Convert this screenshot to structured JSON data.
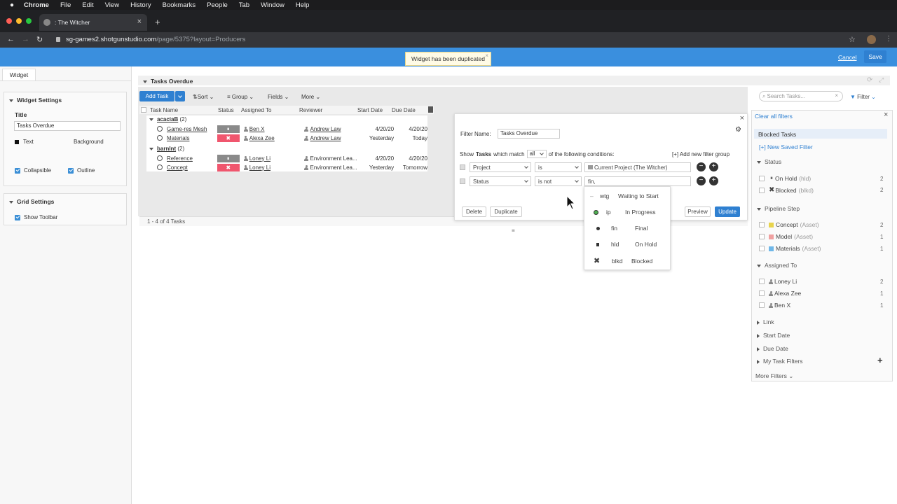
{
  "menubar": {
    "app": "Chrome",
    "items": [
      "File",
      "Edit",
      "View",
      "History",
      "Bookmarks",
      "People",
      "Tab",
      "Window",
      "Help"
    ]
  },
  "browser": {
    "tab_title": ": The Witcher",
    "url_host": "sg-games2.shotgunstudio.com",
    "url_path": "/page/5375?layout=Producers"
  },
  "topbar": {
    "toast": "Widget has been duplicated",
    "cancel": "Cancel",
    "save": "Save"
  },
  "left": {
    "tab": "Widget",
    "widget_settings": "Widget Settings",
    "title_label": "Title",
    "title_value": "Tasks Overdue",
    "text_label": "Text",
    "background_label": "Background",
    "collapsible": "Collapsible",
    "outline": "Outline",
    "grid_settings": "Grid Settings",
    "show_toolbar": "Show Toolbar"
  },
  "widget": {
    "title": "Tasks Overdue",
    "add_task": "Add Task",
    "toolbar": [
      "Sort",
      "Group",
      "Fields",
      "More"
    ],
    "search_placeholder": "Search Tasks...",
    "filter": "Filter",
    "columns": [
      "Task Name",
      "Status",
      "Assigned To",
      "Reviewer",
      "Start Date",
      "Due Date"
    ],
    "groups": [
      {
        "name": "acaciaB",
        "count": "(2)",
        "rows": [
          {
            "task": "Game-res Mesh",
            "status": "hld",
            "assigned": "Ben X",
            "reviewer": "Andrew Law",
            "start": "4/20/20",
            "due": "4/20/20"
          },
          {
            "task": "Materials",
            "status": "blkd",
            "assigned": "Alexa Zee",
            "reviewer": "Andrew Law",
            "start": "Yesterday",
            "due": "Today"
          }
        ]
      },
      {
        "name": "barnInt",
        "count": "(2)",
        "rows": [
          {
            "task": "Reference",
            "status": "hld",
            "assigned": "Loney Li",
            "reviewer": "Environment Lea...",
            "start": "4/20/20",
            "due": "4/20/20"
          },
          {
            "task": "Concept",
            "status": "blkd",
            "assigned": "Loney Li",
            "reviewer": "Environment Lea...",
            "start": "Yesterday",
            "due": "Tomorrow"
          }
        ]
      }
    ],
    "footer": "1 - 4 of 4 Tasks"
  },
  "filter_dialog": {
    "name_label": "Filter Name:",
    "name_value": "Tasks Overdue",
    "show_prefix": "Show",
    "show_entity": "Tasks",
    "show_match": "which match",
    "match_value": "all",
    "show_suffix": "of the following conditions:",
    "add_group": "[+] Add new filter group",
    "conditions": [
      {
        "field": "Project",
        "op": "is",
        "value": "Current Project (The Witcher)"
      },
      {
        "field": "Status",
        "op": "is not",
        "value": "fin,"
      }
    ],
    "delete": "Delete",
    "duplicate": "Duplicate",
    "preview": "Preview",
    "update": "Update",
    "dropdown": [
      {
        "code": "wtg",
        "label": "Waiting to Start"
      },
      {
        "code": "ip",
        "label": "In Progress"
      },
      {
        "code": "fin",
        "label": "Final"
      },
      {
        "code": "hld",
        "label": "On Hold"
      },
      {
        "code": "blkd",
        "label": "Blocked"
      }
    ]
  },
  "filter_panel": {
    "clear": "Clear all filters",
    "saved": "Blocked Tasks",
    "new_saved": "[+] New Saved Filter",
    "status_title": "Status",
    "status_items": [
      {
        "label": "On Hold",
        "code": "(hld)",
        "count": "2"
      },
      {
        "label": "Blocked",
        "code": "(blkd)",
        "count": "2"
      }
    ],
    "pipeline_title": "Pipeline Step",
    "pipeline_items": [
      {
        "label": "Concept",
        "code": "(Asset)",
        "count": "2",
        "color": "#e8d44d"
      },
      {
        "label": "Model",
        "code": "(Asset)",
        "count": "1",
        "color": "#f0a0a0"
      },
      {
        "label": "Materials",
        "code": "(Asset)",
        "count": "1",
        "color": "#6fb7e8"
      }
    ],
    "assigned_title": "Assigned To",
    "assigned_items": [
      {
        "label": "Loney Li",
        "count": "2"
      },
      {
        "label": "Alexa Zee",
        "count": "1"
      },
      {
        "label": "Ben X",
        "count": "1"
      }
    ],
    "link": "Link",
    "start_date": "Start Date",
    "due_date": "Due Date",
    "my_task_filters": "My Task Filters",
    "more_filters": "More Filters"
  },
  "colors": {
    "accent": "#3a8fde",
    "blocked": "#f0566e",
    "hold": "#8a8a8a"
  }
}
